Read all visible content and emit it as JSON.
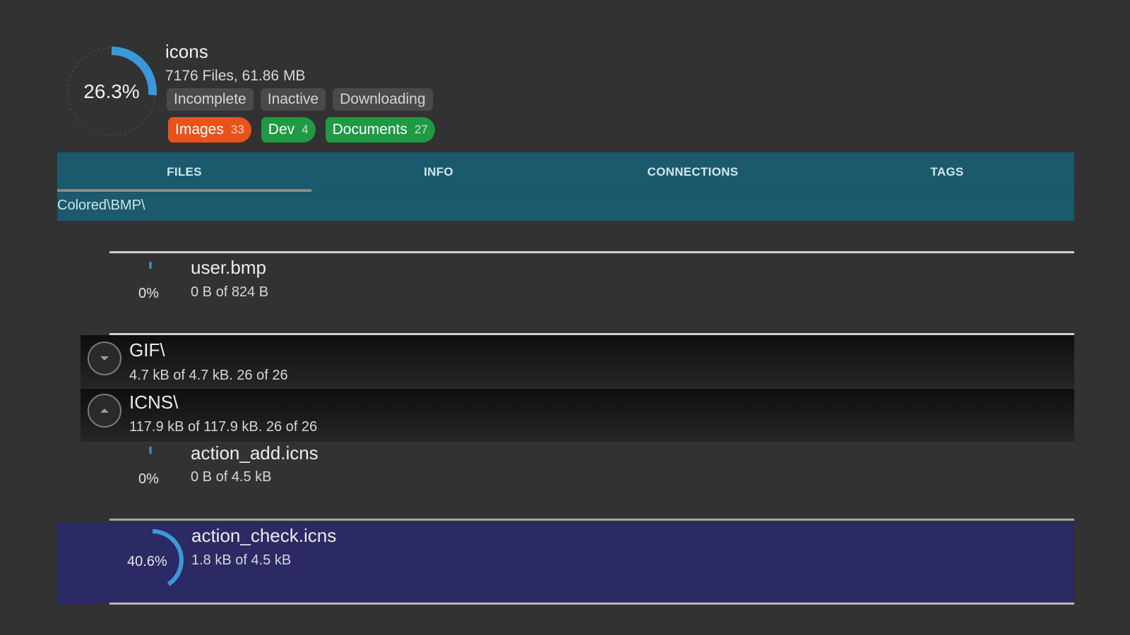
{
  "torrent": {
    "name": "icons",
    "meta": "7176 Files, 61.86 MB",
    "progress_label": "26.3%",
    "progress": 0.263,
    "statuses": [
      "Incomplete",
      "Inactive",
      "Downloading"
    ],
    "tags": [
      {
        "label": "Images",
        "count": "33",
        "color": "#e8531c"
      },
      {
        "label": "Dev",
        "count": "4",
        "color": "#1f9a43"
      },
      {
        "label": "Documents",
        "count": "27",
        "color": "#1f9a43"
      }
    ]
  },
  "tabs": [
    "FILES",
    "INFO",
    "CONNECTIONS",
    "TAGS"
  ],
  "active_tab": "FILES",
  "path": "Colored\\BMP\\",
  "files": {
    "user_bmp": {
      "name": "user.bmp",
      "size": "0 B of 824 B",
      "pct": "0%",
      "progress": 0
    },
    "action_add": {
      "name": "action_add.icns",
      "size": "0 B of 4.5 kB",
      "pct": "0%",
      "progress": 0
    },
    "action_check": {
      "name": "action_check.icns",
      "size": "1.8 kB of 4.5 kB",
      "pct": "40.6%",
      "progress": 0.406
    }
  },
  "folders": {
    "gif": {
      "name": "GIF\\",
      "size": "4.7 kB of 4.7 kB. 26 of 26",
      "icon": "chevron-down-icon"
    },
    "icns": {
      "name": "ICNS\\",
      "size": "117.9 kB of 117.9 kB. 26 of 26",
      "icon": "chevron-up-icon"
    }
  },
  "colors": {
    "accent": "#3a9ad9",
    "tabbar": "#1a5a6c",
    "selected_row": "#2c2a64",
    "background": "#323232"
  }
}
